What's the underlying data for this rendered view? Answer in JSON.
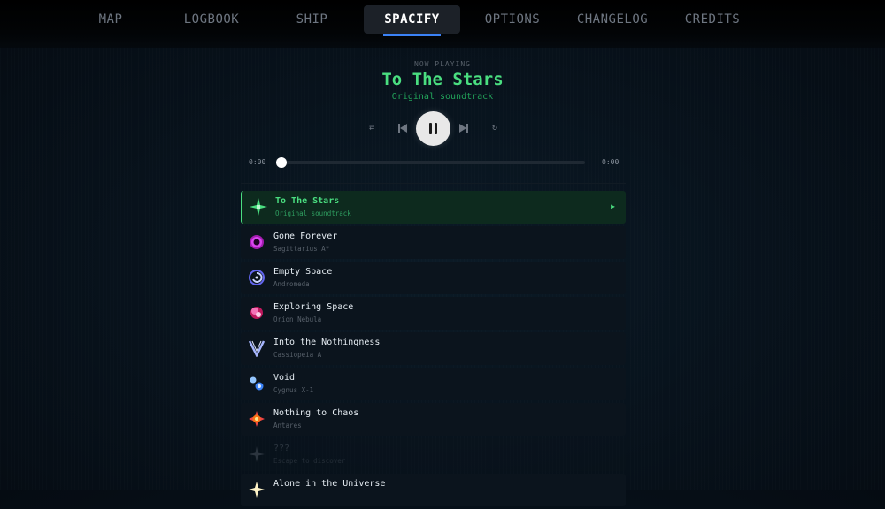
{
  "nav": {
    "items": [
      {
        "label": "MAP"
      },
      {
        "label": "LOGBOOK"
      },
      {
        "label": "SHIP"
      },
      {
        "label": "SPACIFY"
      },
      {
        "label": "OPTIONS"
      },
      {
        "label": "CHANGELOG"
      },
      {
        "label": "CREDITS"
      }
    ],
    "active": "SPACIFY"
  },
  "player": {
    "label": "NOW PLAYING",
    "title": "To The Stars",
    "subtitle": "Original soundtrack",
    "current_time": "0:00",
    "duration": "0:00",
    "progress": 0,
    "shuffle_icon": "⇄",
    "prev_icon": "prev-icon",
    "next_icon": "next-icon",
    "repeat_icon": "↻",
    "state": "playing"
  },
  "songs": [
    {
      "title": "To The Stars",
      "artist": "Original soundtrack",
      "icon": "green-star-icon",
      "active": true,
      "play_marker": "▶"
    },
    {
      "title": "Gone Forever",
      "artist": "Sagittarius A*",
      "icon": "black-hole-icon"
    },
    {
      "title": "Empty Space",
      "artist": "Andromeda",
      "icon": "spiral-galaxy-icon"
    },
    {
      "title": "Exploring Space",
      "artist": "Orion Nebula",
      "icon": "nebula-icon"
    },
    {
      "title": "Into the Nothingness",
      "artist": "Cassiopeia A",
      "icon": "supernova-remnant-icon"
    },
    {
      "title": "Void",
      "artist": "Cygnus X-1",
      "icon": "binary-star-icon"
    },
    {
      "title": "Nothing to Chaos",
      "artist": "Antares",
      "icon": "red-giant-icon"
    },
    {
      "title": "???",
      "artist": "Escape to discover",
      "icon": "locked-star-icon",
      "locked": true
    },
    {
      "title": "Alone in the Universe",
      "artist": "",
      "icon": "white-star-icon"
    }
  ],
  "colors": {
    "accent_green": "#4ade80",
    "nav_underline": "#3b82f6",
    "background": "#08131d"
  }
}
